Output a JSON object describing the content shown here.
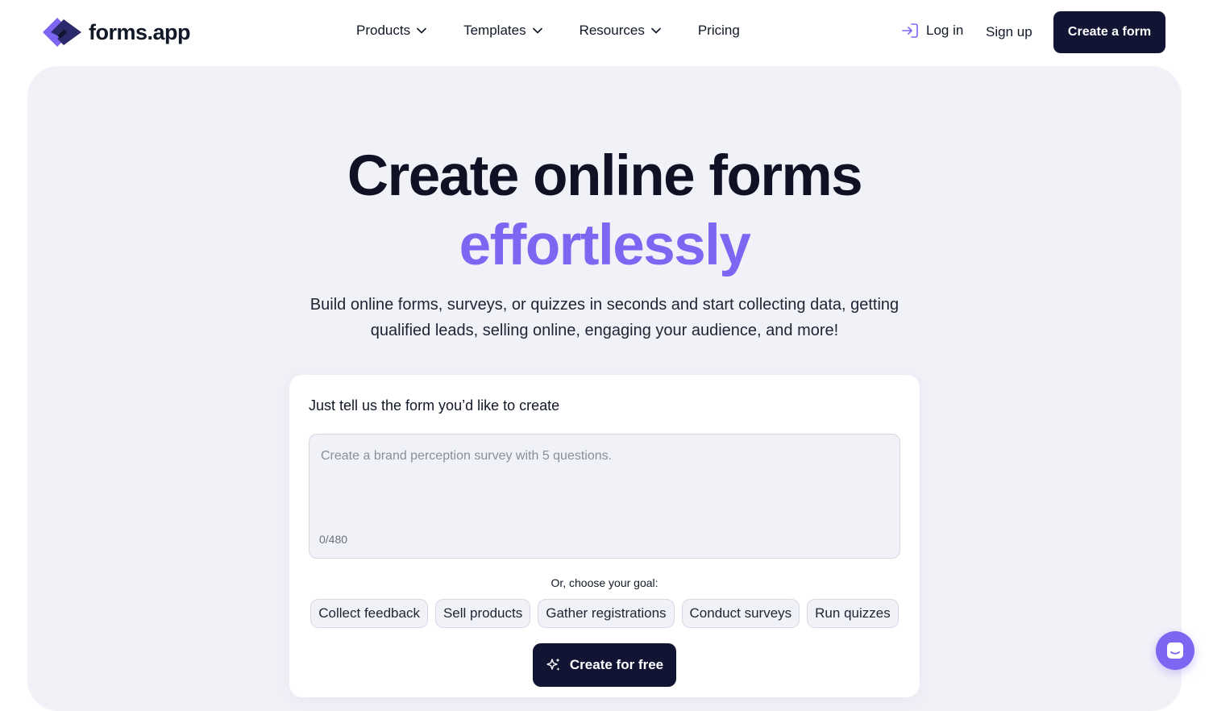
{
  "header": {
    "logo_text": "forms.app",
    "nav": [
      {
        "label": "Products"
      },
      {
        "label": "Templates"
      },
      {
        "label": "Resources"
      },
      {
        "label": "Pricing"
      }
    ],
    "login_label": "Log in",
    "signup_label": "Sign up",
    "create_label": "Create a form"
  },
  "hero": {
    "title_line1": "Create online forms",
    "title_line2": "effortlessly",
    "subtitle_line1": "Build online forms, surveys, or quizzes in seconds and start collecting data, getting",
    "subtitle_line2": "qualified leads, selling online, engaging your audience, and more!"
  },
  "card": {
    "label": "Just tell us the form you’d like to create",
    "placeholder": "Create a brand perception survey with 5 questions.",
    "counter": "0/480",
    "goal_label": "Or, choose your goal:",
    "goals": [
      "Collect feedback",
      "Sell products",
      "Gather registrations",
      "Conduct surveys",
      "Run quizzes"
    ],
    "submit_label": "Create for free"
  },
  "colors": {
    "accent": "#7c66f2",
    "dark": "#111433",
    "hero_bg": "#f1f2f8"
  },
  "icons": {
    "logo": "forms-app-logo-icon",
    "dropdown": "chevron-down-icon",
    "login": "login-arrow-icon",
    "sparkle": "sparkle-icon",
    "chat": "chat-icon"
  }
}
